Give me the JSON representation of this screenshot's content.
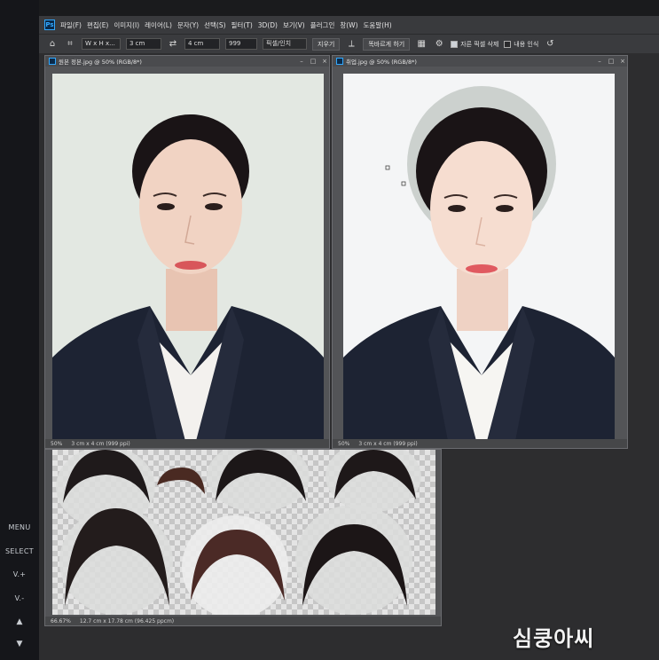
{
  "monitor": {
    "menu": "MENU",
    "select": "SELECT",
    "vplus": "V.+",
    "vminus": "V.-"
  },
  "app": {
    "logo": "Ps",
    "menus": [
      "파일(F)",
      "편집(E)",
      "이미지(I)",
      "레이어(L)",
      "문자(Y)",
      "선택(S)",
      "필터(T)",
      "3D(D)",
      "보기(V)",
      "플러그인",
      "창(W)",
      "도움말(H)"
    ]
  },
  "options": {
    "ratio_select": "W x H x...",
    "width_value": "3 cm",
    "height_value": "4 cm",
    "resolution_value": "999",
    "unit_select": "픽셀/인치",
    "clear_label": "지우기",
    "straighten_label": "똑바르게 하기",
    "delete_cropped_label": "자른 픽셀 삭제",
    "content_aware_label": "내용 인식"
  },
  "doc_left": {
    "title": "원본 정본.jpg @ 50% (RGB/8*)",
    "zoom": "50%",
    "info": "3 cm x 4 cm (999 ppi)"
  },
  "doc_right": {
    "title": "취업.jpg @ 50% (RGB/8*)",
    "zoom": "50%",
    "info": "3 cm x 4 cm (999 ppi)"
  },
  "doc_bottom": {
    "zoom": "66.67%",
    "info": "12.7 cm x 17.78 cm (96.425 ppcm)"
  },
  "watermark": "심쿵아씨",
  "colors": {
    "suit": "#1d2333",
    "skin": "#f1d3c3",
    "hair": "#1a1416",
    "bg_left": "#e3e8e2",
    "bg_right": "#f4f5f6"
  }
}
